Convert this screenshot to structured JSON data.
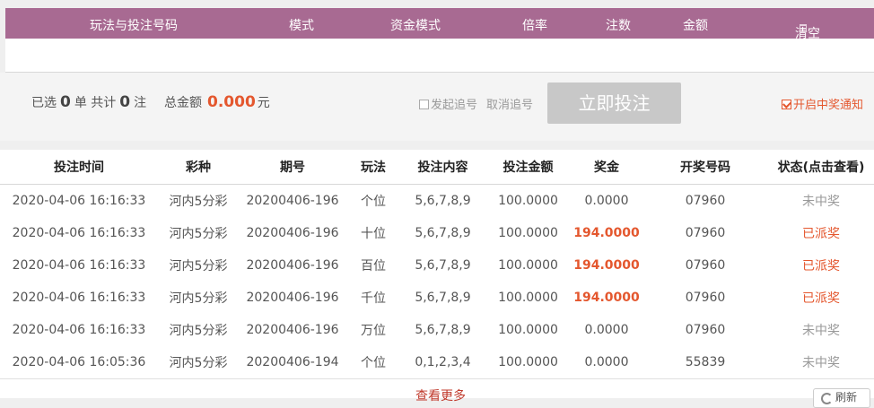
{
  "cart": {
    "headers": {
      "play": "玩法与投注号码",
      "mode": "模式",
      "fund_mode": "资金模式",
      "multiple": "倍率",
      "count": "注数",
      "amount": "金额",
      "clear": "清空"
    }
  },
  "summary": {
    "selected_prefix": "已选",
    "selected_count": "0",
    "selected_unit": "单",
    "total_prefix": "共计",
    "total_count": "0",
    "total_unit": "注",
    "money_label": "总金额",
    "money_value": "0.000",
    "money_unit": "元",
    "chase_label": "发起追号",
    "cancel_chase_label": "取消追号",
    "bet_button": "立即投注",
    "notify_label": "开启中奖通知",
    "notify_checked": true,
    "chase_checked": false
  },
  "records": {
    "columns": [
      "投注时间",
      "彩种",
      "期号",
      "玩法",
      "投注内容",
      "投注金额",
      "奖金",
      "开奖号码",
      "状态(点击查看)"
    ],
    "rows": [
      {
        "time": "2020-04-06 16:16:33",
        "lottery": "河内5分彩",
        "issue": "20200406-196",
        "play": "个位",
        "content": "5,6,7,8,9",
        "bet": "100.0000",
        "prize": "0.0000",
        "draw": "07960",
        "status": "未中奖",
        "won": false
      },
      {
        "time": "2020-04-06 16:16:33",
        "lottery": "河内5分彩",
        "issue": "20200406-196",
        "play": "十位",
        "content": "5,6,7,8,9",
        "bet": "100.0000",
        "prize": "194.0000",
        "draw": "07960",
        "status": "已派奖",
        "won": true
      },
      {
        "time": "2020-04-06 16:16:33",
        "lottery": "河内5分彩",
        "issue": "20200406-196",
        "play": "百位",
        "content": "5,6,7,8,9",
        "bet": "100.0000",
        "prize": "194.0000",
        "draw": "07960",
        "status": "已派奖",
        "won": true
      },
      {
        "time": "2020-04-06 16:16:33",
        "lottery": "河内5分彩",
        "issue": "20200406-196",
        "play": "千位",
        "content": "5,6,7,8,9",
        "bet": "100.0000",
        "prize": "194.0000",
        "draw": "07960",
        "status": "已派奖",
        "won": true
      },
      {
        "time": "2020-04-06 16:16:33",
        "lottery": "河内5分彩",
        "issue": "20200406-196",
        "play": "万位",
        "content": "5,6,7,8,9",
        "bet": "100.0000",
        "prize": "0.0000",
        "draw": "07960",
        "status": "未中奖",
        "won": false
      },
      {
        "time": "2020-04-06 16:05:36",
        "lottery": "河内5分彩",
        "issue": "20200406-194",
        "play": "个位",
        "content": "0,1,2,3,4",
        "bet": "100.0000",
        "prize": "0.0000",
        "draw": "55839",
        "status": "未中奖",
        "won": false
      }
    ],
    "more_label": "查看更多",
    "refresh_label": "刷新"
  },
  "colors": {
    "header_bg": "#a86a92",
    "accent": "#e4572e",
    "button_disabled": "#c8c8c8"
  }
}
